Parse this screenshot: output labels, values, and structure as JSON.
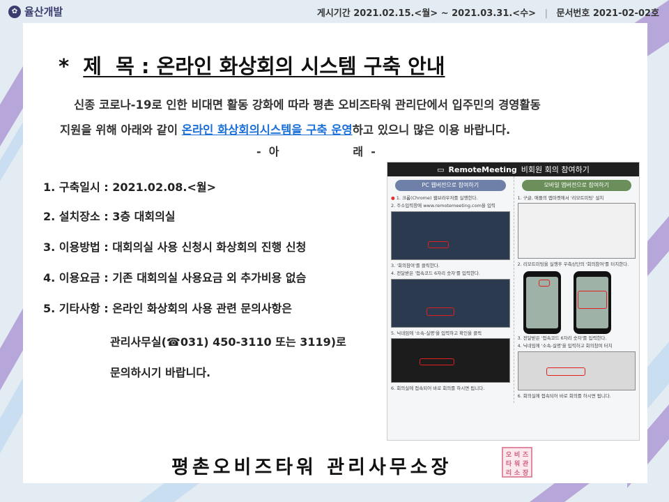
{
  "header": {
    "logo_text": "율산개발",
    "logo_mark": "✿",
    "posting_period": "게시기간 2021.02.15.<월> ~ 2021.03.31.<수>",
    "separator": "|",
    "doc_number": "문서번호 2021-02-02호"
  },
  "notice": {
    "title_star": "*",
    "title": "제  목 : 온라인 화상회의 시스템 구축 안내",
    "intro_line1": "신종 코로나-19로 인한 비대면 활동 강화에 따라 평촌 오비즈타워 관리단에서 입주민의 경영활동",
    "intro_line2_pre": "지원을 위해 아래와 같이 ",
    "intro_line2_highlight": "온라인 화상회의시스템을 구축 운영",
    "intro_line2_post": "하고 있으니 많은 이용 바랍니다.",
    "below_heading": "-  아                   래  -"
  },
  "items": [
    "1. 구축일시 : 2021.02.08.<월>",
    "2. 설치장소 : 3층 대회의실",
    "3. 이용방법 : 대회의실 사용 신청시 화상회의 진행 신청",
    "4. 이용요금 : 기존 대회의실 사용요금 외 추가비용 없슴",
    "5. 기타사항 : 온라인 화상회의 사용 관련 문의사항은"
  ],
  "item5_continued": [
    "관리사무실(☎031) 450-3110 또는 3119)로",
    "문의하시기 바랍니다."
  ],
  "guide": {
    "brand": "RemoteMeeting",
    "heading": "비회원 회의 참여하기",
    "pc_title": "PC 웹버전으로 참여하기",
    "mobile_title": "모바일 앱버전으로 참여하기",
    "pc_steps": [
      "1. 크롬(Chrome) 웹브라우저를 실행한다.",
      "2. 주소입력창에 www.remotemeeting.com을 입력",
      "3. '회의참여'를 클릭한다.",
      "4. 전달받은 '접속코드 6자리 숫자'를 입력한다.",
      "5. 닉네임에 '소속-실명'을 입력하고 확인을 클릭",
      "6. 회의실에 접속되어 바로 회의를 하시면 됩니다."
    ],
    "mobile_steps": [
      "1. 구글, 애플의 앱마켓에서 '리모트미팅' 설치",
      "2. 리모트미팅을 실행후 우측상단의 '회의참여'를 터치한다.",
      "3. 전달받은 '접속코드 6자리 숫자'를 입력한다.",
      "4. 닉네임에 '소속-실명'을 입력하고 회의참여 터치",
      "6. 회의실에 접속되어 바로 회의를 하시면 됩니다."
    ]
  },
  "footer": {
    "office_name": "평촌오비즈타워 관리사무소장",
    "seal_chars": [
      "오",
      "비",
      "즈",
      "타",
      "워",
      "관",
      "리",
      "소",
      "장"
    ]
  }
}
